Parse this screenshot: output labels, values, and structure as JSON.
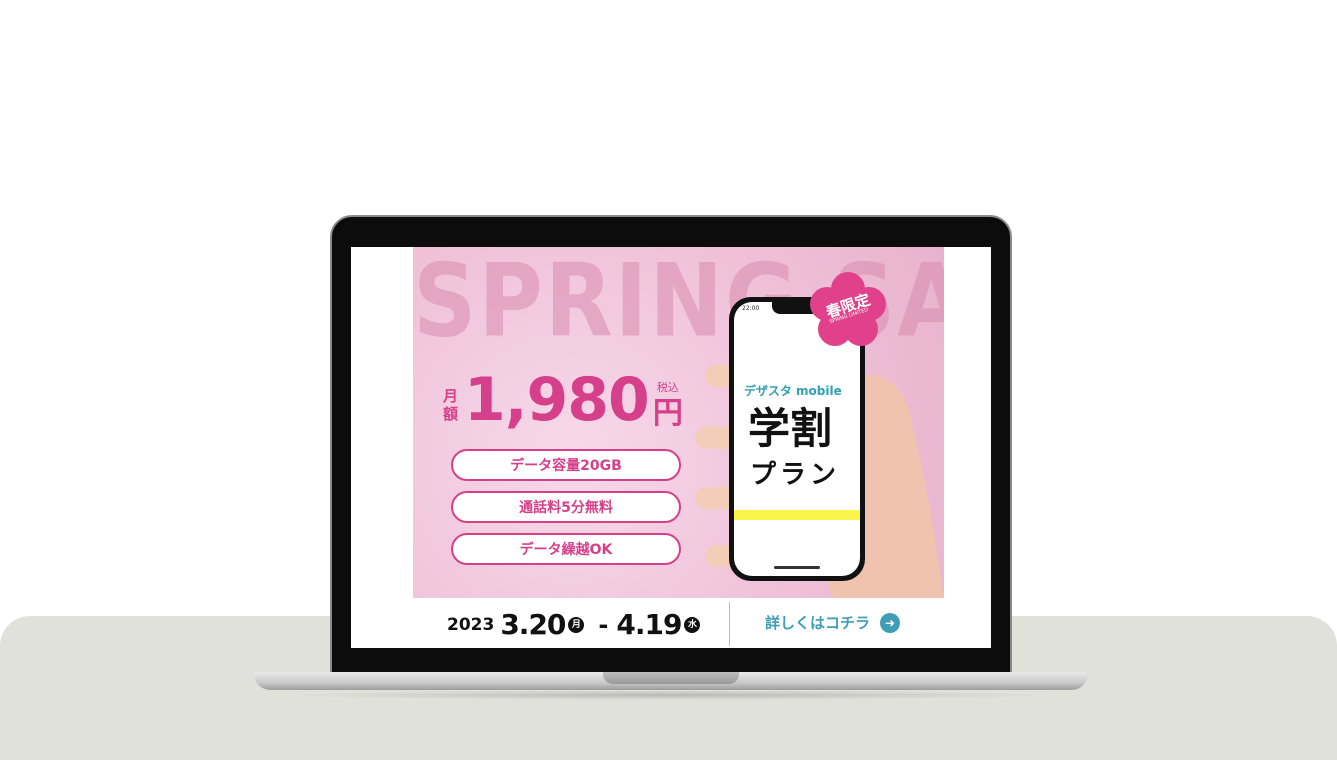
{
  "banner": {
    "bg_title": "SPRING SALE",
    "monthly_label_1": "月",
    "monthly_label_2": "額",
    "price": "1,980",
    "tax_label": "税込",
    "yen": "円",
    "features": [
      "データ容量20GB",
      "通話料5分無料",
      "データ繰越OK"
    ],
    "badge": {
      "text": "春限定",
      "sub": "SPRING LIMITED"
    },
    "phone": {
      "time": "22:00",
      "brand": "デザスタ mobile",
      "plan_main": "学割",
      "plan_sub": "プラン"
    }
  },
  "footer": {
    "year": "2023",
    "start_date": "3.20",
    "start_day": "月",
    "dash": "-",
    "end_date": "4.19",
    "end_day": "水",
    "link_label": "詳しくはコチラ"
  },
  "colors": {
    "accent": "#d6408a",
    "link": "#3f9eb3",
    "highlight": "#fbf54b"
  }
}
